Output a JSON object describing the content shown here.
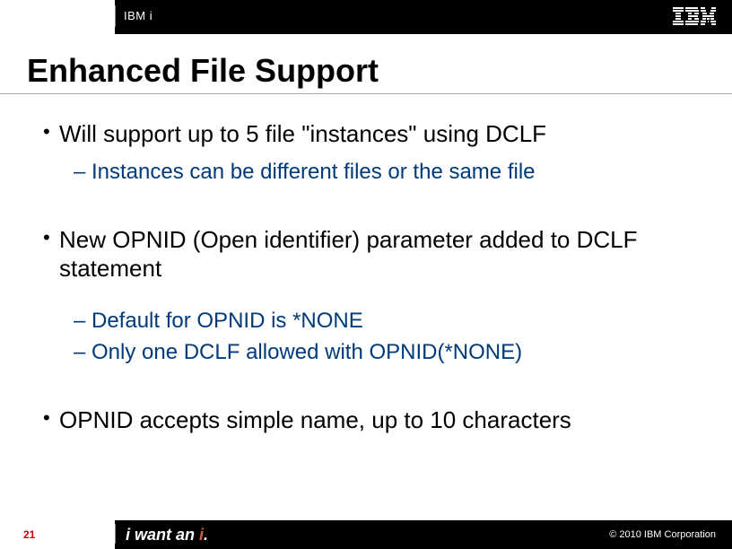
{
  "header": {
    "product": "IBM i",
    "logo_alt": "IBM"
  },
  "title": "Enhanced File Support",
  "bullets": [
    {
      "level": 1,
      "text": "Will support up to 5 file \"instances\" using DCLF"
    },
    {
      "level": 2,
      "text": "Instances can be different files or the same file"
    },
    {
      "level": 1,
      "text": "New OPNID (Open identifier) parameter added to DCLF statement"
    },
    {
      "level": 2,
      "text": "Default for OPNID is *NONE"
    },
    {
      "level": 2,
      "text": "Only one DCLF allowed with OPNID(*NONE)"
    },
    {
      "level": 1,
      "text": "OPNID accepts simple name, up to 10 characters"
    }
  ],
  "footer": {
    "page_number": "21",
    "tagline_prefix": "i want an ",
    "tagline_accent": "i",
    "tagline_suffix": ".",
    "copyright": "© 2010 IBM Corporation"
  }
}
